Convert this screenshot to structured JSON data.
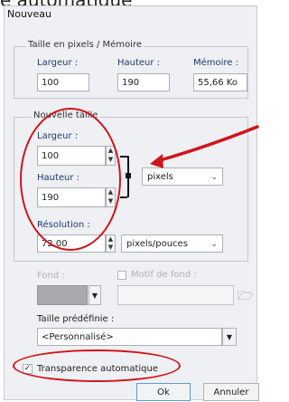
{
  "caption_fragment": "e automatique",
  "window": {
    "title": "Nouveau"
  },
  "size_memory": {
    "title": "Taille en pixels / Mémoire",
    "width_label": "Largeur :",
    "width_value": "100",
    "height_label": "Hauteur :",
    "height_value": "190",
    "memory_label": "Mémoire :",
    "memory_value": "55,66 Ko"
  },
  "new_size": {
    "title": "Nouvelle taille",
    "width_label": "Largeur :",
    "width_value": "100",
    "height_label": "Hauteur :",
    "height_value": "190",
    "unit_selected": "pixels",
    "resolution_label": "Résolution :",
    "resolution_value": "72,00",
    "resolution_unit_selected": "pixels/pouces"
  },
  "background": {
    "fill_label": "Fond :",
    "pattern_label": "Motif de fond :"
  },
  "preset": {
    "label": "Taille prédéfinie :",
    "selected": "<Personnalisé>"
  },
  "transparency": {
    "label": "Transparence automatique",
    "checked": true
  },
  "buttons": {
    "ok": "Ok",
    "cancel": "Annuler"
  },
  "annotation_color": "#d0141b"
}
